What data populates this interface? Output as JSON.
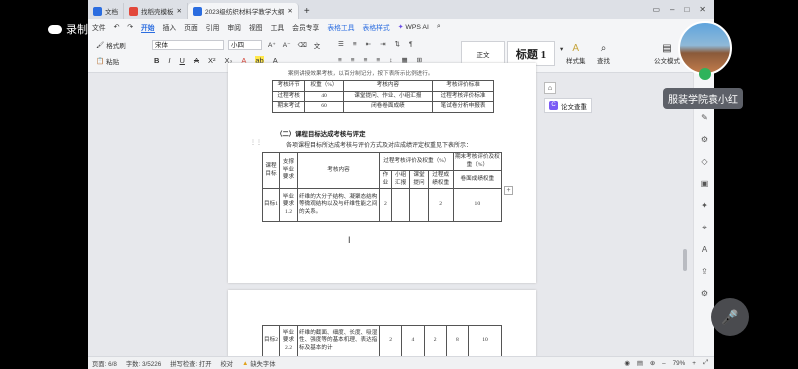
{
  "recording": {
    "label": "录制中"
  },
  "tabs": [
    {
      "label": "文档",
      "color": "#2b6de0"
    },
    {
      "label": "找稻壳模板",
      "color": "#e2483b"
    },
    {
      "label": "2023级纺织材料学教学大纲",
      "color": "#2b6de0"
    }
  ],
  "menu": {
    "file": "文件",
    "items": [
      "开始",
      "插入",
      "页面",
      "引用",
      "审阅",
      "视图",
      "工具",
      "会员专享"
    ],
    "extra": [
      "表格工具",
      "表格样式"
    ],
    "wps_ai": "WPS AI"
  },
  "ribbon": {
    "format_painter": "格式刷",
    "paste": "粘贴",
    "font_name": "宋体",
    "font_size": "小四",
    "style_normal": "正文",
    "style_h1": "标题 1",
    "styles_label": "样式集",
    "find_label": "查找",
    "format_label": "公文模式"
  },
  "paper_check": "论文查重",
  "page1": {
    "top_text": "案例讲授效果考核，以百分制记分，按下表所示比例进行。",
    "table1": {
      "header": [
        "考核环节",
        "权重（%）",
        "考核内容",
        "考核评价标准"
      ],
      "rows": [
        [
          "过程考核",
          "40",
          "课堂提问、作业、小组汇报",
          "过程考核评价标准"
        ],
        [
          "期末考试",
          "60",
          "闭卷卷面成绩",
          "笔试卷分析申报表"
        ]
      ]
    },
    "heading": "（二）课程目标达成考核与评定",
    "para": "各项课程目标所达成考核与评价方式及对应成绩评定权重见下表所示：",
    "t2": {
      "c_goal": "课程目标",
      "c_req": "支撑毕业要求",
      "c_content": "考核内容",
      "c_proc": "过程考核评价及权重（%）",
      "c_final": "期末考核评价及权重（%）",
      "sub": [
        "作业",
        "小组汇报",
        "课堂提问",
        "过程成绩权重",
        "卷面成绩权重"
      ],
      "row": {
        "goal": "目标1",
        "req": "毕业要求1.2",
        "content": "纤维的大分子结构、凝聚态结构等微观结构以及与纤维性能之间的关系。",
        "v": [
          "2",
          "",
          "",
          "2",
          "10"
        ]
      }
    }
  },
  "page2": {
    "row": {
      "goal": "目标2",
      "req": "毕业要求2.2",
      "content": "纤维的截面、细度、长度、吸湿性、强度等的基本机理、表达指标及基本的计",
      "v": [
        "2",
        "4",
        "2",
        "8",
        "10"
      ]
    }
  },
  "status": {
    "page": "页面: 6/8",
    "words": "字数: 3/5226",
    "spell": "拼写检查: 打开",
    "proof": "校对",
    "missing_font": "缺失字体",
    "zoom": "79%"
  },
  "user": {
    "name": "服装学院袁小红"
  }
}
